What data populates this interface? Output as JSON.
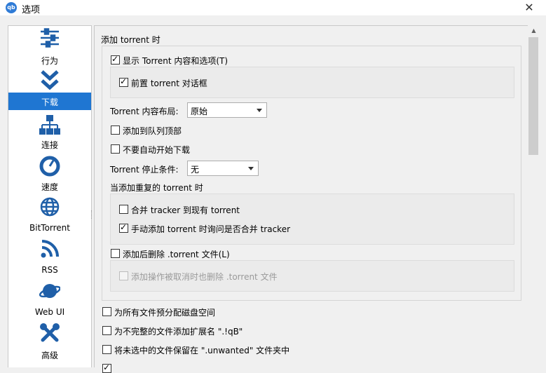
{
  "window": {
    "title": "选项",
    "app_icon": "qb",
    "close_symbol": "✕"
  },
  "sidebar": {
    "items": [
      {
        "label": "行为",
        "icon": "sliders-icon"
      },
      {
        "label": "下载",
        "icon": "double-chevron-down-icon",
        "selected": true
      },
      {
        "label": "连接",
        "icon": "network-icon"
      },
      {
        "label": "速度",
        "icon": "speedometer-icon"
      },
      {
        "label": "BitTorrent",
        "icon": "globe-icon"
      },
      {
        "label": "RSS",
        "icon": "rss-icon"
      },
      {
        "label": "Web UI",
        "icon": "planet-icon"
      },
      {
        "label": "高级",
        "icon": "tools-icon"
      }
    ]
  },
  "add_torrent": {
    "group_title": "添加 torrent 时",
    "show_content_label": "显示 Torrent 内容和选项(T)",
    "show_content_checked": true,
    "foreground_dialog_label": "前置 torrent 对话框",
    "foreground_dialog_checked": true,
    "layout_label": "Torrent 内容布局:",
    "layout_value": "原始",
    "add_to_top_label": "添加到队列顶部",
    "add_to_top_checked": false,
    "no_autostart_label": "不要自动开始下载",
    "no_autostart_checked": false,
    "stop_condition_label": "Torrent 停止条件:",
    "stop_condition_value": "无",
    "duplicate_title": "当添加重复的 torrent 时",
    "merge_trackers_label": "合并 tracker 到现有 torrent",
    "merge_trackers_checked": false,
    "ask_merge_label": "手动添加 torrent 时询问是否合并 tracker",
    "ask_merge_checked": true,
    "delete_after_label": "添加后删除 .torrent 文件(L)",
    "delete_after_checked": false,
    "delete_on_cancel_label": "添加操作被取消时也删除 .torrent 文件",
    "delete_on_cancel_checked": false
  },
  "options": {
    "preallocate_label": "为所有文件预分配磁盘空间",
    "preallocate_checked": false,
    "append_ext_label": "为不完整的文件添加扩展名 \".!qB\"",
    "append_ext_checked": false,
    "unwanted_folder_label": "将未选中的文件保留在 \".unwanted\" 文件夹中",
    "unwanted_folder_checked": false
  }
}
